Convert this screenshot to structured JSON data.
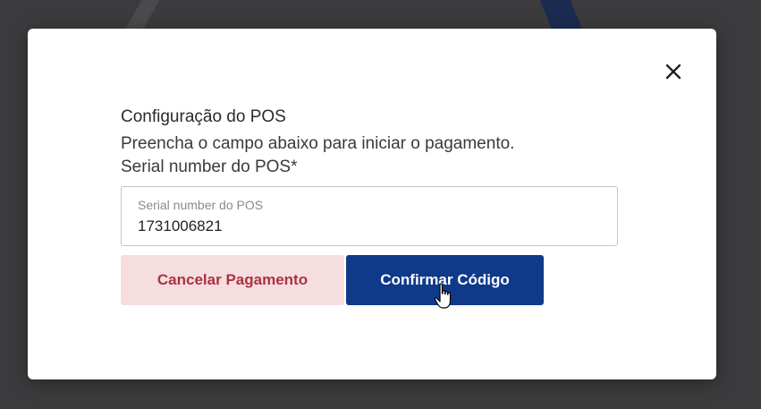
{
  "modal": {
    "close_icon": "close-icon",
    "title": "Configuração do POS",
    "description": "Preencha o campo abaixo para iniciar o pagamento.",
    "field_label": "Serial number do POS*",
    "input": {
      "floating_label": "Serial number do POS",
      "value": "1731006821"
    },
    "buttons": {
      "cancel_label": "Cancelar Pagamento",
      "confirm_label": "Confirmar Código"
    }
  },
  "colors": {
    "confirm_bg": "#0f3a8a",
    "cancel_bg": "#f6dde0",
    "cancel_text": "#a8343f",
    "backdrop": "#3b3b3d"
  }
}
